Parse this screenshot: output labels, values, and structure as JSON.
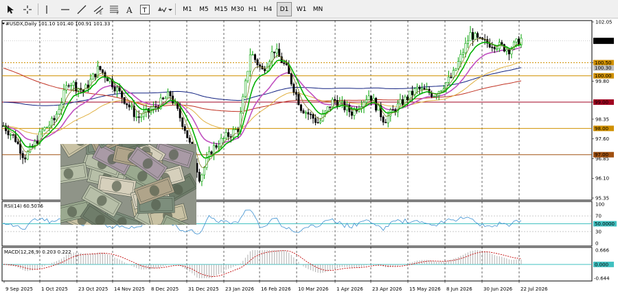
{
  "toolbar": {
    "tools": [
      {
        "name": "cursor-icon"
      },
      {
        "name": "crosshair-icon"
      },
      {
        "name": "vertical-line-icon"
      },
      {
        "name": "horizontal-line-icon"
      },
      {
        "name": "trendline-icon"
      },
      {
        "name": "equidistant-channel-icon"
      },
      {
        "name": "fibonacci-icon"
      },
      {
        "name": "text-label-icon",
        "label": "A"
      },
      {
        "name": "text-box-icon",
        "label": "T"
      },
      {
        "name": "shapes-icon"
      }
    ],
    "timeframes": [
      "M1",
      "M5",
      "M15",
      "M30",
      "H1",
      "H4",
      "D1",
      "W1",
      "MN"
    ],
    "active_timeframe": "D1"
  },
  "header": {
    "symbol_line": "#USDX,Daily  101.10 101.40 100.91 101.33"
  },
  "price_axis": {
    "ticks": [
      "102.05",
      "100.50",
      "99.80",
      "99.00",
      "98.35",
      "97.60",
      "96.85",
      "96.10",
      "95.35"
    ],
    "current_price": "101.33",
    "level_labels": [
      "100.50",
      "100.30",
      "100.00",
      "99.00",
      "98.00",
      "97.00"
    ]
  },
  "rsi": {
    "label": "RSI(14) 60.5076",
    "ticks": [
      "100",
      "70",
      "30",
      "0"
    ],
    "value_label": "50.0000"
  },
  "macd": {
    "label": "MACD(12,26,9) 0.203 0.222",
    "ticks": [
      "0.666",
      "0.000",
      "-0.644"
    ]
  },
  "time_axis": {
    "labels": [
      "9 Sep 2025",
      "1 Oct 2025",
      "23 Oct 2025",
      "14 Nov 2025",
      "8 Dec 2025",
      "31 Dec 2025",
      "23 Jan 2026",
      "16 Feb 2026",
      "10 Mar 2026",
      "1 Apr 2026",
      "23 Apr 2026",
      "15 May 2026",
      "8 Jun 2026",
      "30 Jun 2026",
      "22 Jul 2026"
    ]
  },
  "colors": {
    "bull_candle": "#00a000",
    "bear_candle": "#000000",
    "ema_fast": "#00b000",
    "ema_mid": "#c050c0",
    "ema_slow": "#e0b040",
    "ma_navy": "#102080",
    "ma_brown": "#c03020",
    "level_red": "#a00020",
    "level_orange": "#d09000",
    "rsi_line": "#3a8fd0",
    "rsi_level": "#40c0c0",
    "macd_signal": "#c00000",
    "macd_hist": "#b0b0b0"
  }
}
